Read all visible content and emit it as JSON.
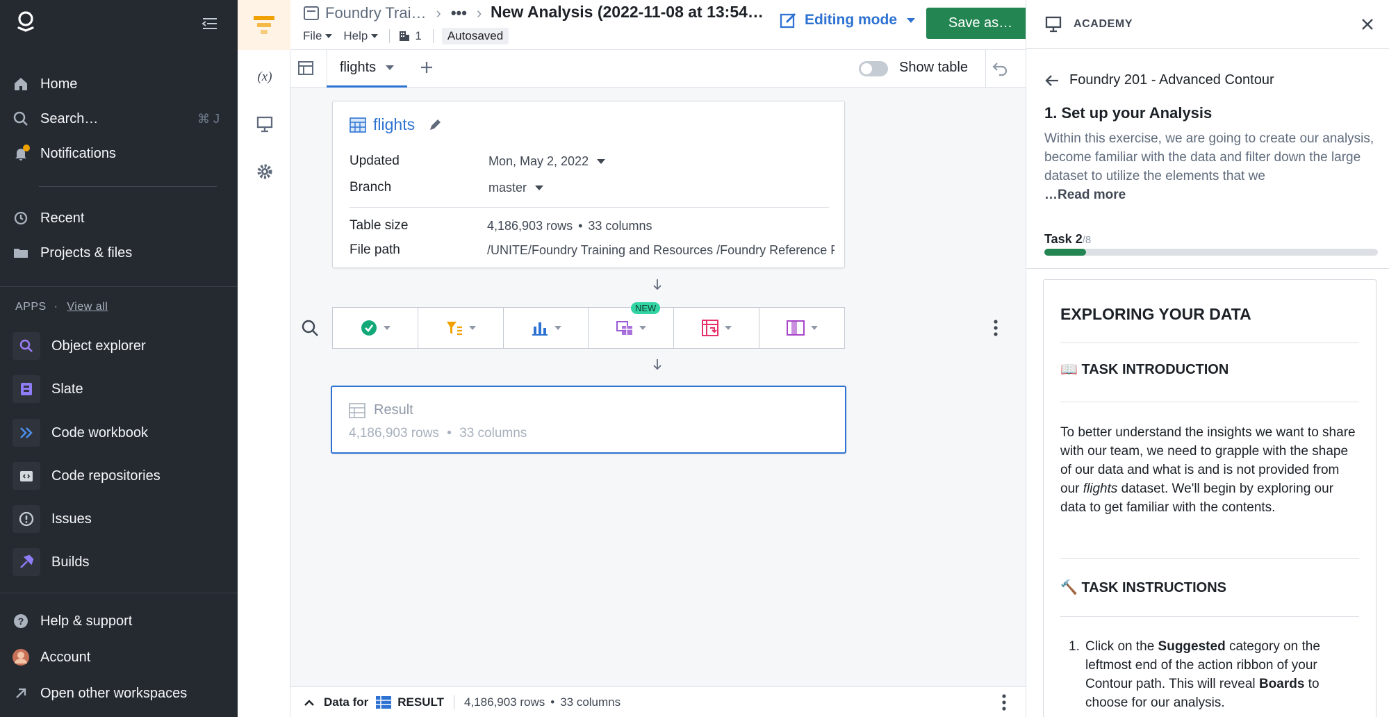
{
  "sidebar": {
    "nav": [
      {
        "label": "Home",
        "icon": "home-icon"
      },
      {
        "label": "Search…",
        "icon": "search-icon",
        "shortcut": "⌘ J"
      },
      {
        "label": "Notifications",
        "icon": "bell-icon"
      },
      {
        "label": "Recent",
        "icon": "history-icon"
      },
      {
        "label": "Projects & files",
        "icon": "folder-icon"
      }
    ],
    "apps_heading": "APPS",
    "view_all": "View all",
    "apps": [
      {
        "label": "Object explorer",
        "icon": "object-explorer-icon"
      },
      {
        "label": "Slate",
        "icon": "slate-icon"
      },
      {
        "label": "Code workbook",
        "icon": "code-workbook-icon"
      },
      {
        "label": "Code repositories",
        "icon": "code-repositories-icon"
      },
      {
        "label": "Issues",
        "icon": "issues-icon"
      },
      {
        "label": "Builds",
        "icon": "builds-icon"
      }
    ],
    "bottom": [
      {
        "label": "Help & support",
        "icon": "help-icon"
      },
      {
        "label": "Account",
        "icon": "avatar"
      },
      {
        "label": "Open other workspaces",
        "icon": "arrow-up-right-icon"
      }
    ]
  },
  "rail": {
    "variables_label": "(x)"
  },
  "topbar": {
    "breadcrumb_folder": "Foundry Trai…",
    "breadcrumb_ellipsis": "•••",
    "title": "New Analysis (2022-11-08 at 13:54…",
    "menu_file": "File",
    "menu_help": "Help",
    "users_count": "1",
    "autosaved": "Autosaved",
    "editing_mode": "Editing mode",
    "save_as": "Save as…"
  },
  "tabbar": {
    "tab_label": "flights",
    "show_table": "Show table"
  },
  "dataset_card": {
    "title": "flights",
    "updated_label": "Updated",
    "updated_value": "Mon, May 2, 2022",
    "branch_label": "Branch",
    "branch_value": "master",
    "size_label": "Table size",
    "size_rows": "4,186,903 rows",
    "size_cols": "33 columns",
    "path_label": "File path",
    "path_value": "/UNITE/Foundry Training and Resources /Foundry Reference Project/Ontolo…"
  },
  "ribbon": {
    "new_badge": "NEW",
    "colors": {
      "suggested": "#13a877",
      "filter": "#f0a000",
      "chart": "#2d72d2",
      "join": "#9b5bd6",
      "pivot": "#e5306a",
      "columns": "#a845c9"
    }
  },
  "result_card": {
    "title": "Result",
    "rows": "4,186,903 rows",
    "cols": "33 columns"
  },
  "bottom_bar": {
    "data_for": "Data for",
    "result": "RESULT",
    "rows": "4,186,903 rows",
    "cols": "33 columns"
  },
  "academy": {
    "heading": "ACADEMY",
    "course": "Foundry 201 - Advanced Contour",
    "section_title": "1. Set up your Analysis",
    "description": "Within this exercise, we are going to create our analysis, become familiar with the data and filter down the large dataset to utilize the elements that we",
    "read_more": "…Read more",
    "task_current": "Task 2",
    "task_total": "/8",
    "progress": 0.125,
    "card_title": "EXPLORING YOUR DATA",
    "intro_heading": "📖 TASK INTRODUCTION",
    "intro_text_1": "To better understand the insights we want to share with our team, we need to grapple with the shape of our data and what is and is not provided from our ",
    "intro_text_em": "flights",
    "intro_text_2": " dataset. We'll begin by exploring our data to get familiar with the contents.",
    "instructions_heading": "🔨 TASK INSTRUCTIONS",
    "step_1": "Click on the ",
    "step_1_bold": "Suggested",
    "step_1_b": " category on the leftmost end of the action ribbon of your Contour path. This will reveal ",
    "step_1_bold2": "Boards",
    "step_1_c": " to choose for our analysis."
  }
}
